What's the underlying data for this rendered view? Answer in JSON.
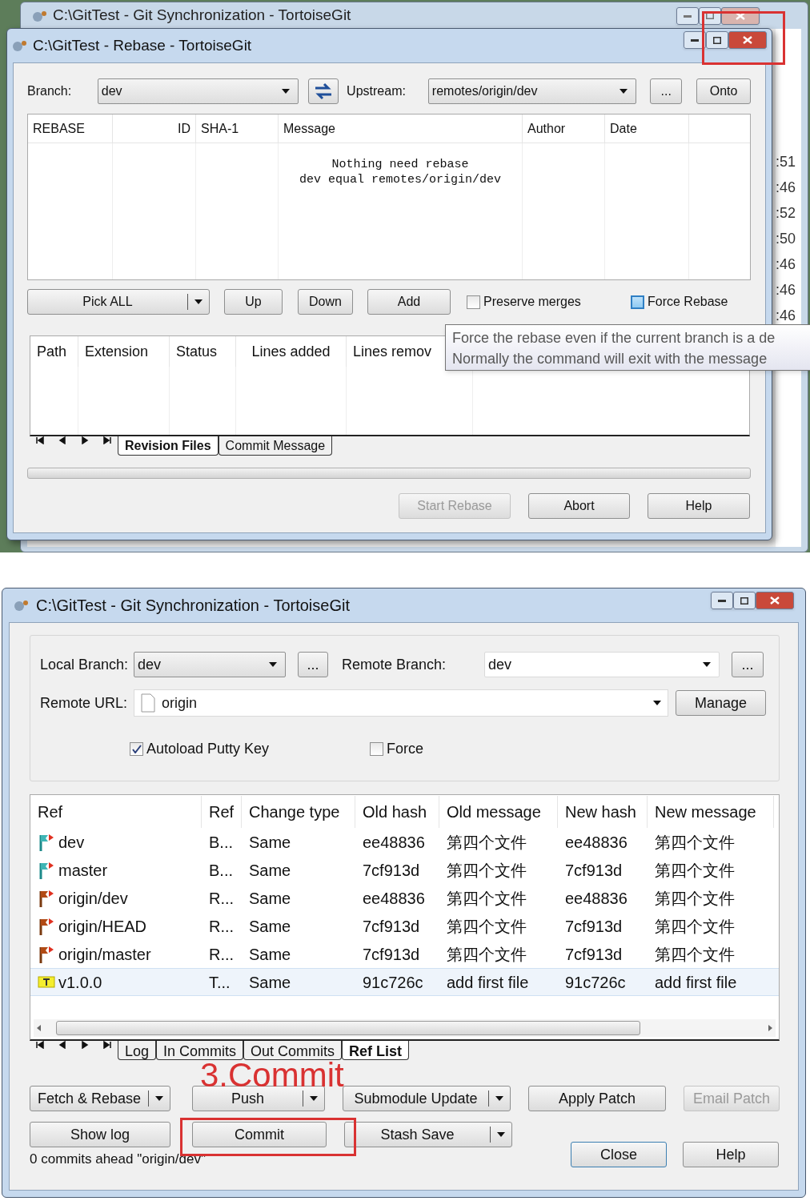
{
  "background_window": {
    "title": "C:\\GitTest - Git Synchronization - TortoiseGit",
    "times": [
      ":51",
      ":46",
      ":52",
      ":50",
      ":46",
      ":46",
      ":46"
    ]
  },
  "rebase_window": {
    "title": "C:\\GitTest - Rebase - TortoiseGit",
    "branch_label": "Branch:",
    "branch": "dev",
    "upstream_label": "Upstream:",
    "upstream": "remotes/origin/dev",
    "more_button": "...",
    "onto_button": "Onto",
    "commit_columns": [
      "REBASE",
      "ID",
      "SHA-1",
      "Message",
      "Author",
      "Date"
    ],
    "empty_message": [
      "Nothing need rebase",
      "dev equal remotes/origin/dev"
    ],
    "pick_button": "Pick ALL",
    "buttons": [
      "Up",
      "Down",
      "Add"
    ],
    "checkboxes": [
      {
        "label": "Preserve merges",
        "checked": false,
        "hovered": false
      },
      {
        "label": "Force Rebase",
        "checked": false,
        "hovered": true
      }
    ],
    "progress": {
      "level": 0
    },
    "file_columns": [
      "Path",
      "Extension",
      "Status",
      "Lines added",
      "Lines remov"
    ],
    "tabs": [
      {
        "label": "Revision Files",
        "selected": true
      },
      {
        "label": "Commit Message",
        "selected": false
      }
    ],
    "footer_buttons": [
      {
        "label": "Start Rebase",
        "disabled": true
      },
      {
        "label": "Abort",
        "disabled": false
      },
      {
        "label": "Help",
        "disabled": false
      }
    ],
    "tooltip": [
      "Force the rebase even if the current branch is a de",
      "Normally the command will exit with the message"
    ]
  },
  "sync_window": {
    "title": "C:\\GitTest - Git Synchronization - TortoiseGit",
    "local_branch_label": "Local Branch:",
    "local_branch": "dev",
    "more_button": "...",
    "remote_branch_label": "Remote Branch:",
    "remote_branch": "dev",
    "remote_url_label": "Remote URL:",
    "remote_url": "origin",
    "manage_button": "Manage",
    "checkboxes": [
      {
        "label": "Autoload Putty Key",
        "checked": true
      },
      {
        "label": "Force",
        "checked": false
      }
    ],
    "columns": [
      "Ref",
      "Ref",
      "Change type",
      "Old hash",
      "Old message",
      "New hash",
      "New message"
    ],
    "rows": [
      {
        "kind": "local",
        "selected": false,
        "cells": [
          "dev",
          "B...",
          "Same",
          "ee48836",
          "第四个文件",
          "ee48836",
          "第四个文件"
        ]
      },
      {
        "kind": "local",
        "selected": false,
        "cells": [
          "master",
          "B...",
          "Same",
          "7cf913d",
          "第四个文件",
          "7cf913d",
          "第四个文件"
        ]
      },
      {
        "kind": "remote",
        "selected": false,
        "cells": [
          "origin/dev",
          "R...",
          "Same",
          "ee48836",
          "第四个文件",
          "ee48836",
          "第四个文件"
        ]
      },
      {
        "kind": "remote",
        "selected": false,
        "cells": [
          "origin/HEAD",
          "R...",
          "Same",
          "7cf913d",
          "第四个文件",
          "7cf913d",
          "第四个文件"
        ]
      },
      {
        "kind": "remote",
        "selected": false,
        "cells": [
          "origin/master",
          "R...",
          "Same",
          "7cf913d",
          "第四个文件",
          "7cf913d",
          "第四个文件"
        ]
      },
      {
        "kind": "tag",
        "selected": true,
        "cells": [
          "v1.0.0",
          "T...",
          "Same",
          "91c726c",
          "add first file",
          "91c726c",
          "add first file"
        ]
      }
    ],
    "tabs": [
      {
        "label": "Log",
        "selected": false
      },
      {
        "label": "In Commits",
        "selected": false
      },
      {
        "label": "Out Commits",
        "selected": false
      },
      {
        "label": "Ref List",
        "selected": true
      }
    ],
    "button_rows": [
      [
        {
          "label": "Fetch & Rebase",
          "dropdown": true,
          "disabled": false
        },
        {
          "label": "Push",
          "dropdown": true,
          "disabled": false
        },
        {
          "label": "Submodule Update",
          "dropdown": true,
          "disabled": false
        },
        {
          "label": "Apply Patch",
          "dropdown": false,
          "disabled": false
        },
        {
          "label": "Email Patch",
          "dropdown": false,
          "disabled": true
        }
      ],
      [
        {
          "label": "Show log",
          "dropdown": false,
          "disabled": false
        },
        {
          "label": "Commit",
          "dropdown": false,
          "disabled": false
        },
        {
          "label": "Stash Save",
          "dropdown": true,
          "disabled": false
        }
      ]
    ],
    "close_button": "Close",
    "help_button": "Help",
    "status": "0 commits ahead \"origin/dev\""
  },
  "annotation": {
    "step_label": "3.Commit"
  }
}
